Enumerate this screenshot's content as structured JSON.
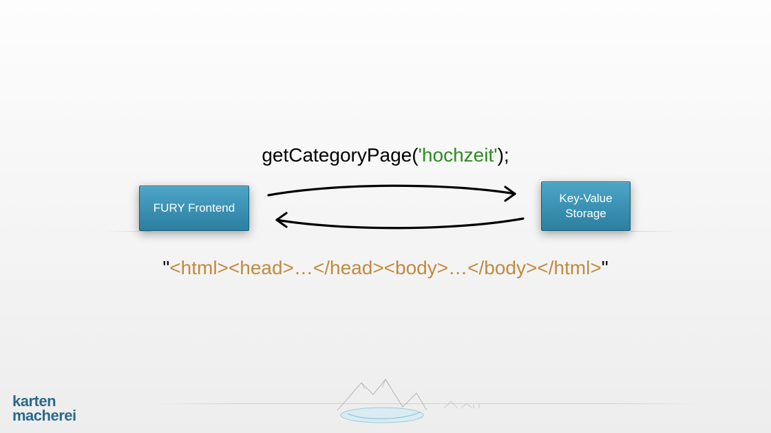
{
  "diagram": {
    "call": {
      "fn": "getCategoryPage(",
      "arg": "'hochzeit'",
      "suffix": ");"
    },
    "left_box": "FURY Frontend",
    "right_box": "Key-Value\nStorage",
    "return": {
      "quote": "\"",
      "html": "<html><head>…</head><body>…</body></html>"
    }
  },
  "logo": {
    "line1": "karten",
    "line2": "macherei"
  }
}
